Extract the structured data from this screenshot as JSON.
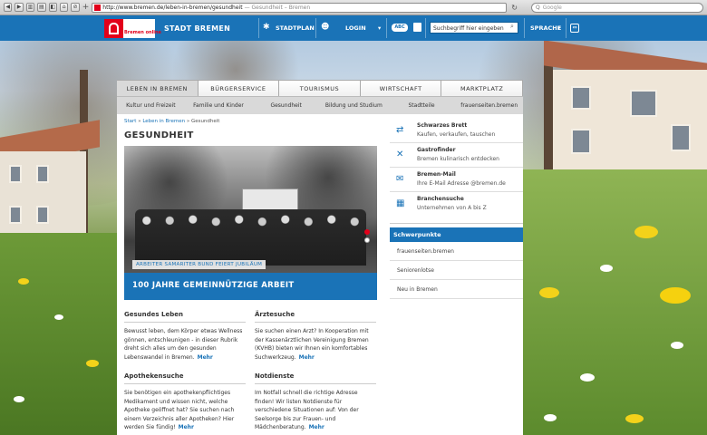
{
  "browser": {
    "url": "http://www.bremen.de/leben-in-bremen/gesundheit",
    "page_title": "Gesundheit – Bremen",
    "search_placeholder": "Google",
    "reload_glyph": "↻",
    "search_glyph": "Q",
    "new_tab_glyph": "+"
  },
  "header": {
    "logo_text": "Bremen online",
    "site_name": "STADT BREMEN",
    "stadtplan": "STADTPLAN",
    "login": "LOGIN",
    "login_caret": "▾",
    "accessibility_badge": "ABC",
    "search_placeholder": "Suchbegriff hier eingeben",
    "sprache": "SPRACHE",
    "sprache_caret": "▾",
    "share_glyph": "⇔",
    "stadtplan_glyph": "✱",
    "login_glyph": "☻",
    "search_glyph": "⌕"
  },
  "nav": {
    "tabs": [
      "LEBEN IN BREMEN",
      "BÜRGERSERVICE",
      "TOURISMUS",
      "WIRTSCHAFT",
      "MARKTPLATZ"
    ],
    "subitems": [
      "Kultur und Freizeit",
      "Familie und Kinder",
      "Gesundheit",
      "Bildung und Studium",
      "Stadtteile",
      "frauenseiten.bremen"
    ]
  },
  "breadcrumb": {
    "items": [
      "Start",
      "Leben in Bremen",
      "Gesundheit"
    ],
    "separator": "»"
  },
  "page": {
    "title": "GESUNDHEIT"
  },
  "hero": {
    "caption": "ARBEITER SAMARITER BUND FEIERT JUBILÄUM",
    "title": "100 JAHRE GEMEINNÜTZIGE ARBEIT",
    "slide_count": 2,
    "active_slide": 1
  },
  "teasers": [
    {
      "title": "Gesundes Leben",
      "text": "Bewusst leben, dem Körper etwas Wellness gönnen, entschleunigen - in dieser Rubrik dreht sich alles um den gesunden Lebenswandel in Bremen.",
      "more": "Mehr"
    },
    {
      "title": "Ärztesuche",
      "text": "Sie suchen einen Arzt? In Kooperation mit der Kassenärztlichen Vereinigung Bremen (KVHB) bieten wir Ihnen ein komfortables Suchwerkzeug.",
      "more": "Mehr"
    },
    {
      "title": "Apothekensuche",
      "text": "Sie benötigen ein apothekenpflichtiges Medikament und wissen nicht, welche Apotheke geöffnet hat? Sie suchen nach einem Verzeichnis aller Apotheken? Hier werden Sie fündig!",
      "more": "Mehr"
    },
    {
      "title": "Notdienste",
      "text": "Im Notfall schnell die richtige Adresse finden! Wir listen Notdienste für verschiedene Situationen auf: Von der Seelsorge bis zur Frauen- und Mädchenberatung.",
      "more": "Mehr"
    }
  ],
  "services": [
    {
      "title": "Schwarzes Brett",
      "subtitle": "Kaufen, verkaufen, tauschen",
      "icon": "exchange-icon",
      "glyph": "⇄"
    },
    {
      "title": "Gastrofinder",
      "subtitle": "Bremen kulinarisch entdecken",
      "icon": "cutlery-icon",
      "glyph": "✕"
    },
    {
      "title": "Bremen-Mail",
      "subtitle": "Ihre E-Mail Adresse @bremen.de",
      "icon": "mail-icon",
      "glyph": "✉"
    },
    {
      "title": "Branchensuche",
      "subtitle": "Unternehmen von A bis Z",
      "icon": "buildings-icon",
      "glyph": "▦"
    }
  ],
  "schwerpunkte": {
    "title": "Schwerpunkte",
    "links": [
      "frauenseiten.bremen",
      "Seniorenlotse",
      "Neu in Bremen"
    ]
  },
  "colors": {
    "brand_blue": "#1a73b7",
    "brand_red": "#e2001a"
  }
}
